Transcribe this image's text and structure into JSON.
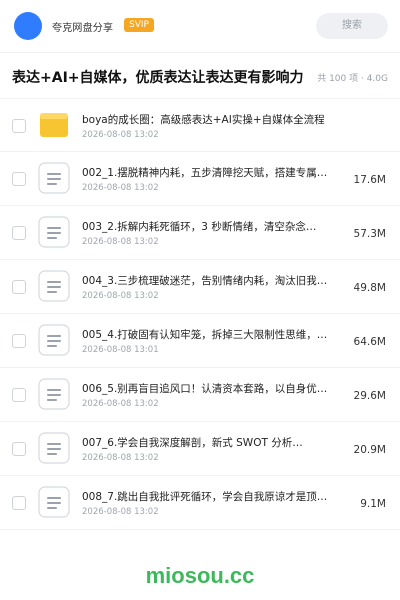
{
  "header": {
    "brand": "夸克网盘分享",
    "badge": "SVIP",
    "search_placeholder": "搜索",
    "avatar_color": "#2f7cff",
    "badge_color": "#f5a623"
  },
  "share": {
    "title": "表达+AI+自媒体，优质表达让表达更有影响力",
    "meta": "共 100 项 · 4.0G"
  },
  "items": [
    {
      "type": "folder-icon",
      "name": "boya的成长圈：高级感表达+AI实操+自媒体全流程",
      "date": "2026-08-08 13:02",
      "size": ""
    },
    {
      "type": "document-icon",
      "name": "002_1.摆脱精神内耗，五步清障挖天赋，搭建专属…",
      "date": "2026-08-08 13:02",
      "size": "17.6M"
    },
    {
      "type": "document-icon",
      "name": "003_2.拆解内耗死循环，3 秒断情绪，清空杂念…",
      "date": "2026-08-08 13:02",
      "size": "57.3M"
    },
    {
      "type": "document-icon",
      "name": "004_3.三步梳理破迷茫，告别情绪内耗，淘汰旧我…",
      "date": "2026-08-08 13:02",
      "size": "49.8M"
    },
    {
      "type": "document-icon",
      "name": "005_4.打破固有认知牢笼，拆掉三大限制性思维，…",
      "date": "2026-08-08 13:01",
      "size": "64.6M"
    },
    {
      "type": "document-icon",
      "name": "006_5.别再盲目追风口！认清资本套路，以自身优…",
      "date": "2026-08-08 13:02",
      "size": "29.6M"
    },
    {
      "type": "document-icon",
      "name": "007_6.学会自我深度解剖，新式 SWOT 分析…",
      "date": "2026-08-08 13:02",
      "size": "20.9M"
    },
    {
      "type": "document-icon",
      "name": "008_7.跳出自我批评死循环，学会自我原谅才是顶…",
      "date": "2026-08-08 13:02",
      "size": "9.1M"
    }
  ],
  "footer": {
    "watermark": "miosou.cc"
  }
}
